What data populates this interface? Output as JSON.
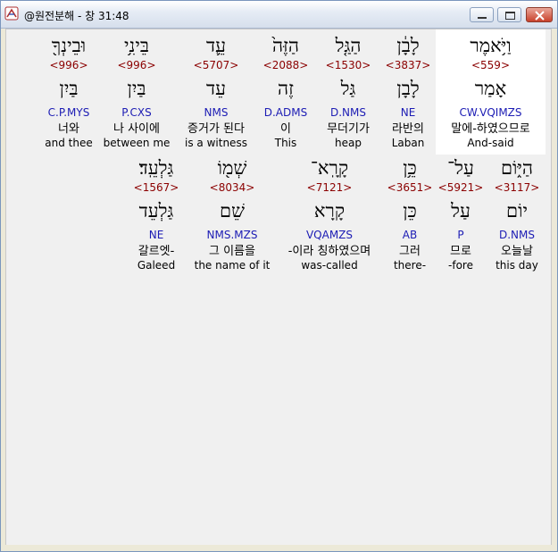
{
  "window": {
    "title": "@원전분해 - 창 31:48"
  },
  "row1": [
    {
      "hebrew": "וַיֹּ֥אמֶר",
      "strong": "<559>",
      "lexeme": "אָמַר",
      "morph": "CW.VQIMZS",
      "korean": "말에-하였으므로",
      "english": "And-said"
    },
    {
      "hebrew": "לָבָ֔ן",
      "strong": "<3837>",
      "lexeme": "לָבָן",
      "morph": "NE",
      "korean": "라반의",
      "english": "Laban"
    },
    {
      "hebrew": "הַגַּ֤ל",
      "strong": "<1530>",
      "lexeme": "גַּל",
      "morph": "D.NMS",
      "korean": "무더기가",
      "english": "heap"
    },
    {
      "hebrew": "הַזֶּה֙",
      "strong": "<2088>",
      "lexeme": "זֶה",
      "morph": "D.ADMS",
      "korean": "이",
      "english": "This"
    },
    {
      "hebrew": "עֵ֛ד",
      "strong": "<5707>",
      "lexeme": "עֵד",
      "morph": "NMS",
      "korean": "증거가 된다",
      "english": "is a witness"
    },
    {
      "hebrew": "בֵּינִ֥י",
      "strong": "<996>",
      "lexeme": "בַּיִן",
      "morph": "P.CXS",
      "korean": "나 사이에",
      "english": "between me"
    },
    {
      "hebrew": "וּבֵינְךָ֖",
      "strong": "<996>",
      "lexeme": "בַּיִן",
      "morph": "C.P.MYS",
      "korean": "너와",
      "english": "and thee"
    }
  ],
  "row2": [
    {
      "hebrew": "הַיּ֑וֹם",
      "strong": "<3117>",
      "lexeme": "יוֹם",
      "morph": "D.NMS",
      "korean": "오늘날",
      "english": "this day"
    },
    {
      "hebrew": "עַל־",
      "strong": "<5921>",
      "lexeme": "עַל",
      "morph": "P",
      "korean": "므로",
      "english": "-fore"
    },
    {
      "hebrew": "כֵּ֥ן",
      "strong": "<3651>",
      "lexeme": "כֵּן",
      "morph": "AB",
      "korean": "그러",
      "english": "there-"
    },
    {
      "hebrew": "קָרָֽא־",
      "strong": "<7121>",
      "lexeme": "קָרָא",
      "morph": "VQAMZS",
      "korean": "-이라 칭하였으며",
      "english": "was-called"
    },
    {
      "hebrew": "שְׁמ֖וֹ",
      "strong": "<8034>",
      "lexeme": "שֵׁם",
      "morph": "NMS.MZS",
      "korean": "그 이름을",
      "english": "the name of it"
    },
    {
      "hebrew": "גַּלְעֵֽד׃",
      "strong": "<1567>",
      "lexeme": "גַּלְעֵד",
      "morph": "NE",
      "korean": "갈르엣-",
      "english": "Galeed"
    }
  ]
}
